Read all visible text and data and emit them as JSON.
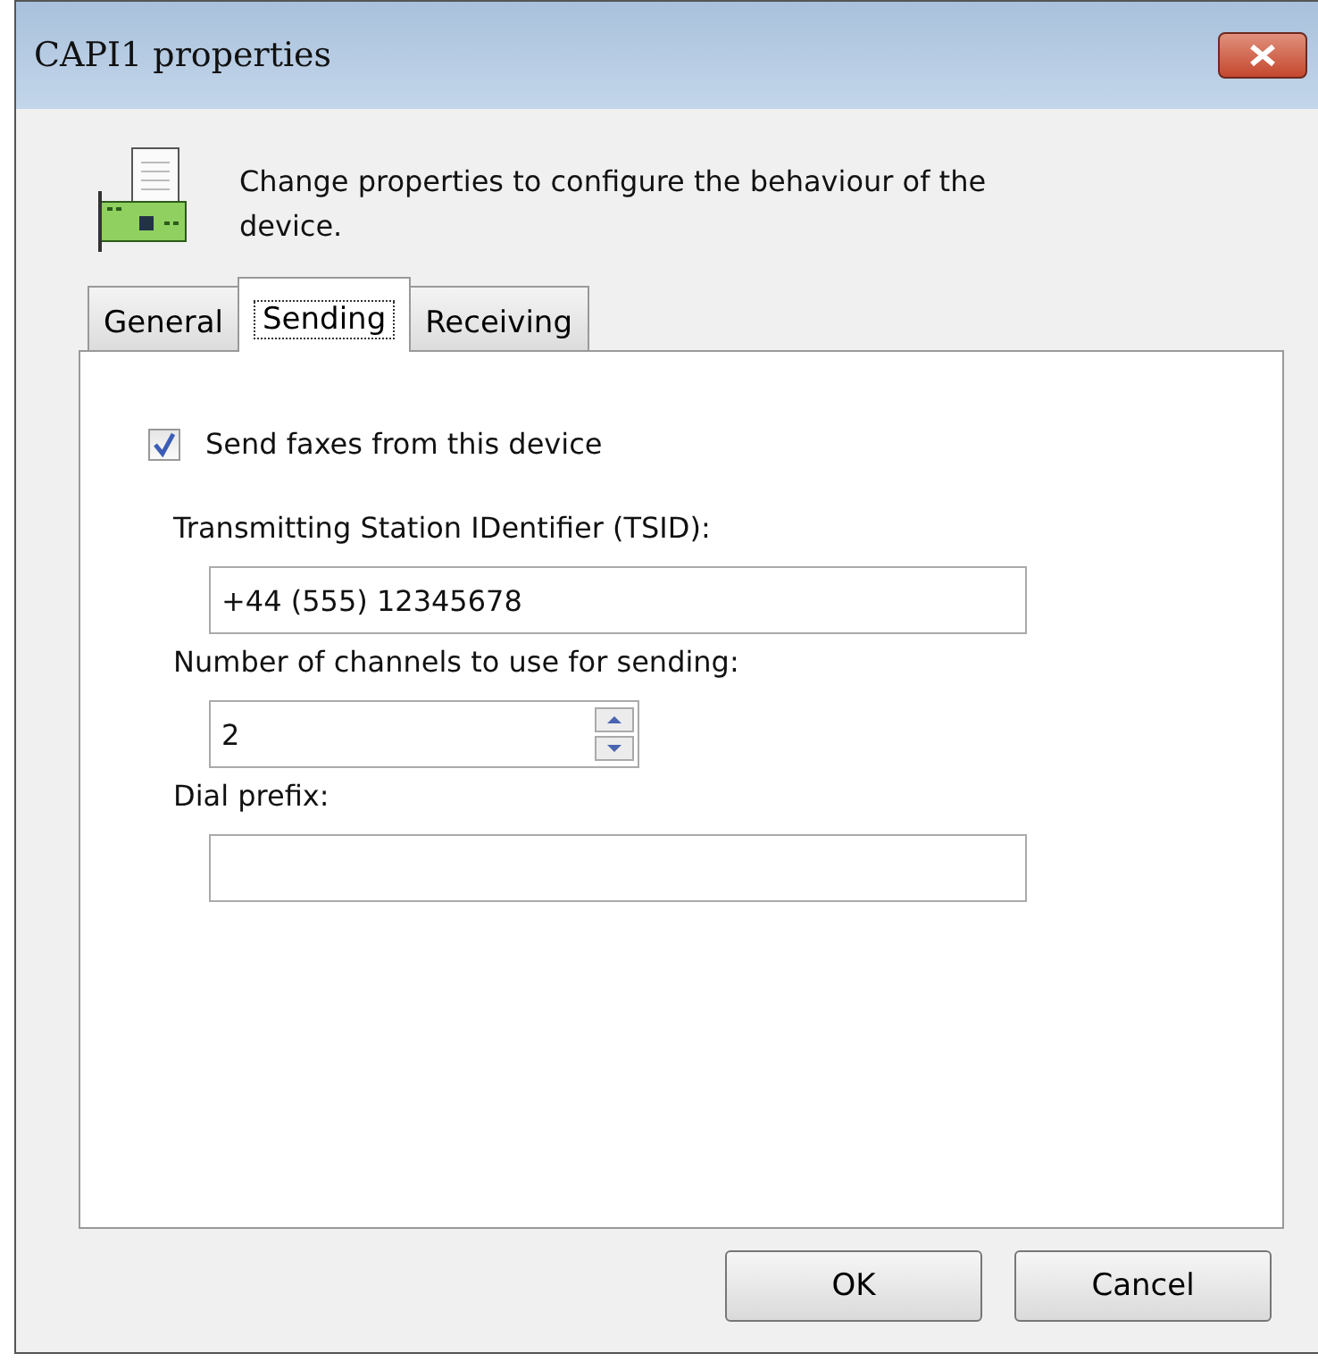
{
  "window": {
    "title": "CAPI1 properties"
  },
  "header": {
    "description": "Change properties to configure the behaviour of the device."
  },
  "tabs": [
    {
      "label": "General",
      "selected": false
    },
    {
      "label": "Sending",
      "selected": true
    },
    {
      "label": "Receiving",
      "selected": false
    }
  ],
  "send_faxes": {
    "label": "Send faxes from this device",
    "checked": true
  },
  "fields": [
    {
      "kind": "text",
      "label": "Transmitting Station IDentifier (TSID):",
      "value": "+44 (555) 12345678"
    },
    {
      "kind": "spin",
      "label": "Number of channels to use for sending:",
      "value": "2"
    },
    {
      "kind": "text",
      "label": "Dial prefix:"
    }
  ],
  "buttons": [
    "OK",
    "Cancel"
  ]
}
